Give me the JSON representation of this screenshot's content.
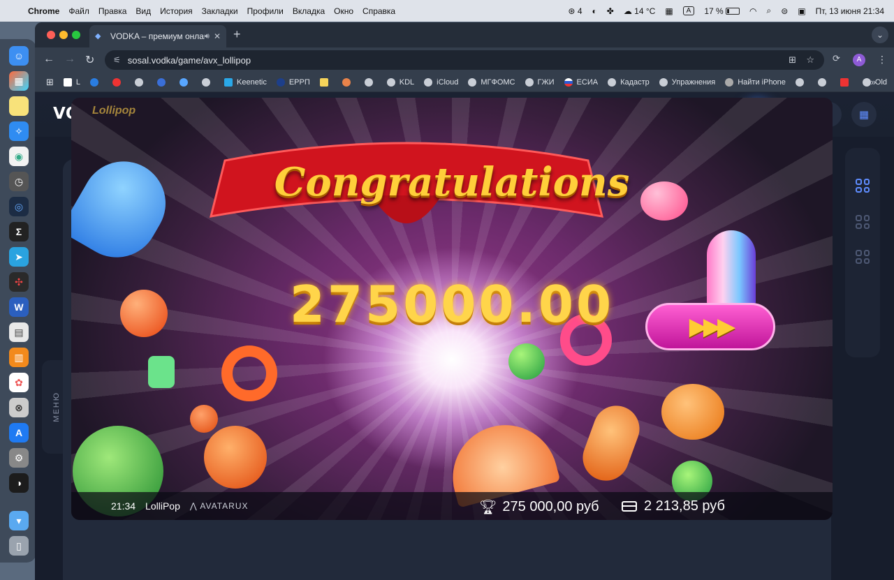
{
  "menubar": {
    "app": "Chrome",
    "items": [
      "Файл",
      "Правка",
      "Вид",
      "История",
      "Закладки",
      "Профили",
      "Вкладка",
      "Окно",
      "Справка"
    ],
    "status": {
      "notifications": "4",
      "weather": "14 °C",
      "input": "A",
      "battery": "17 %",
      "battery_level": 0.17,
      "datetime": "Пт, 13 июня  21:34"
    }
  },
  "browser": {
    "tab_title": "VODKA – премиум онлай",
    "url": "sosal.vodka/game/avx_lollipop",
    "bookmarks": [
      "L",
      "",
      "",
      "",
      "",
      "",
      "",
      "Keenetic",
      "ЕРРП",
      "",
      "",
      "",
      "KDL",
      "iCloud",
      "МГФОМС",
      "ГЖИ",
      "ЕСИА",
      "Кадастр",
      "Упражнения",
      "Найти iPhone",
      "",
      "",
      "",
      "Old"
    ]
  },
  "site": {
    "logo": "VODKA.BET",
    "currency_symbol": "₽",
    "menu_label": "МЕНЮ"
  },
  "game": {
    "logo": "Lollipop",
    "congrats": "Congratulations",
    "win_display": "275000.00",
    "hud": {
      "time": "21:34",
      "name": "LolliPop",
      "provider": "AVATARUX",
      "win": "275 000,00 руб",
      "balance": "2 213,85 руб"
    }
  }
}
